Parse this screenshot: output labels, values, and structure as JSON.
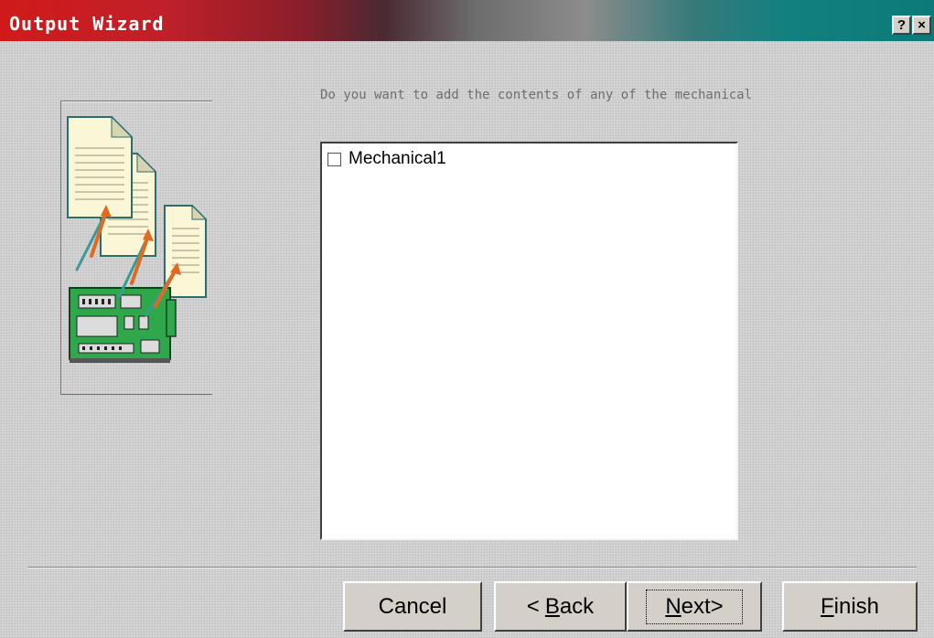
{
  "window": {
    "title": "Output Wizard",
    "help_glyph": "?",
    "close_glyph": "×"
  },
  "illustration": {
    "icon": "documents-to-pcb-icon",
    "colors": {
      "paper": "#fbf7d6",
      "board": "#2ea84a",
      "arrow": "#e06a20",
      "accent": "#2a8f8a"
    }
  },
  "question": {
    "text": "Do you want to add the contents of any of the mechanical"
  },
  "list": {
    "items": [
      {
        "label": "Mechanical1",
        "checked": false
      }
    ]
  },
  "buttons": {
    "cancel": {
      "label": "Cancel"
    },
    "back": {
      "arrow": "<",
      "mnemonic": "B",
      "rest": "ack"
    },
    "next": {
      "mnemonic": "N",
      "rest": "ext",
      "arrow": ">"
    },
    "finish": {
      "mnemonic": "F",
      "rest": "inish"
    }
  }
}
